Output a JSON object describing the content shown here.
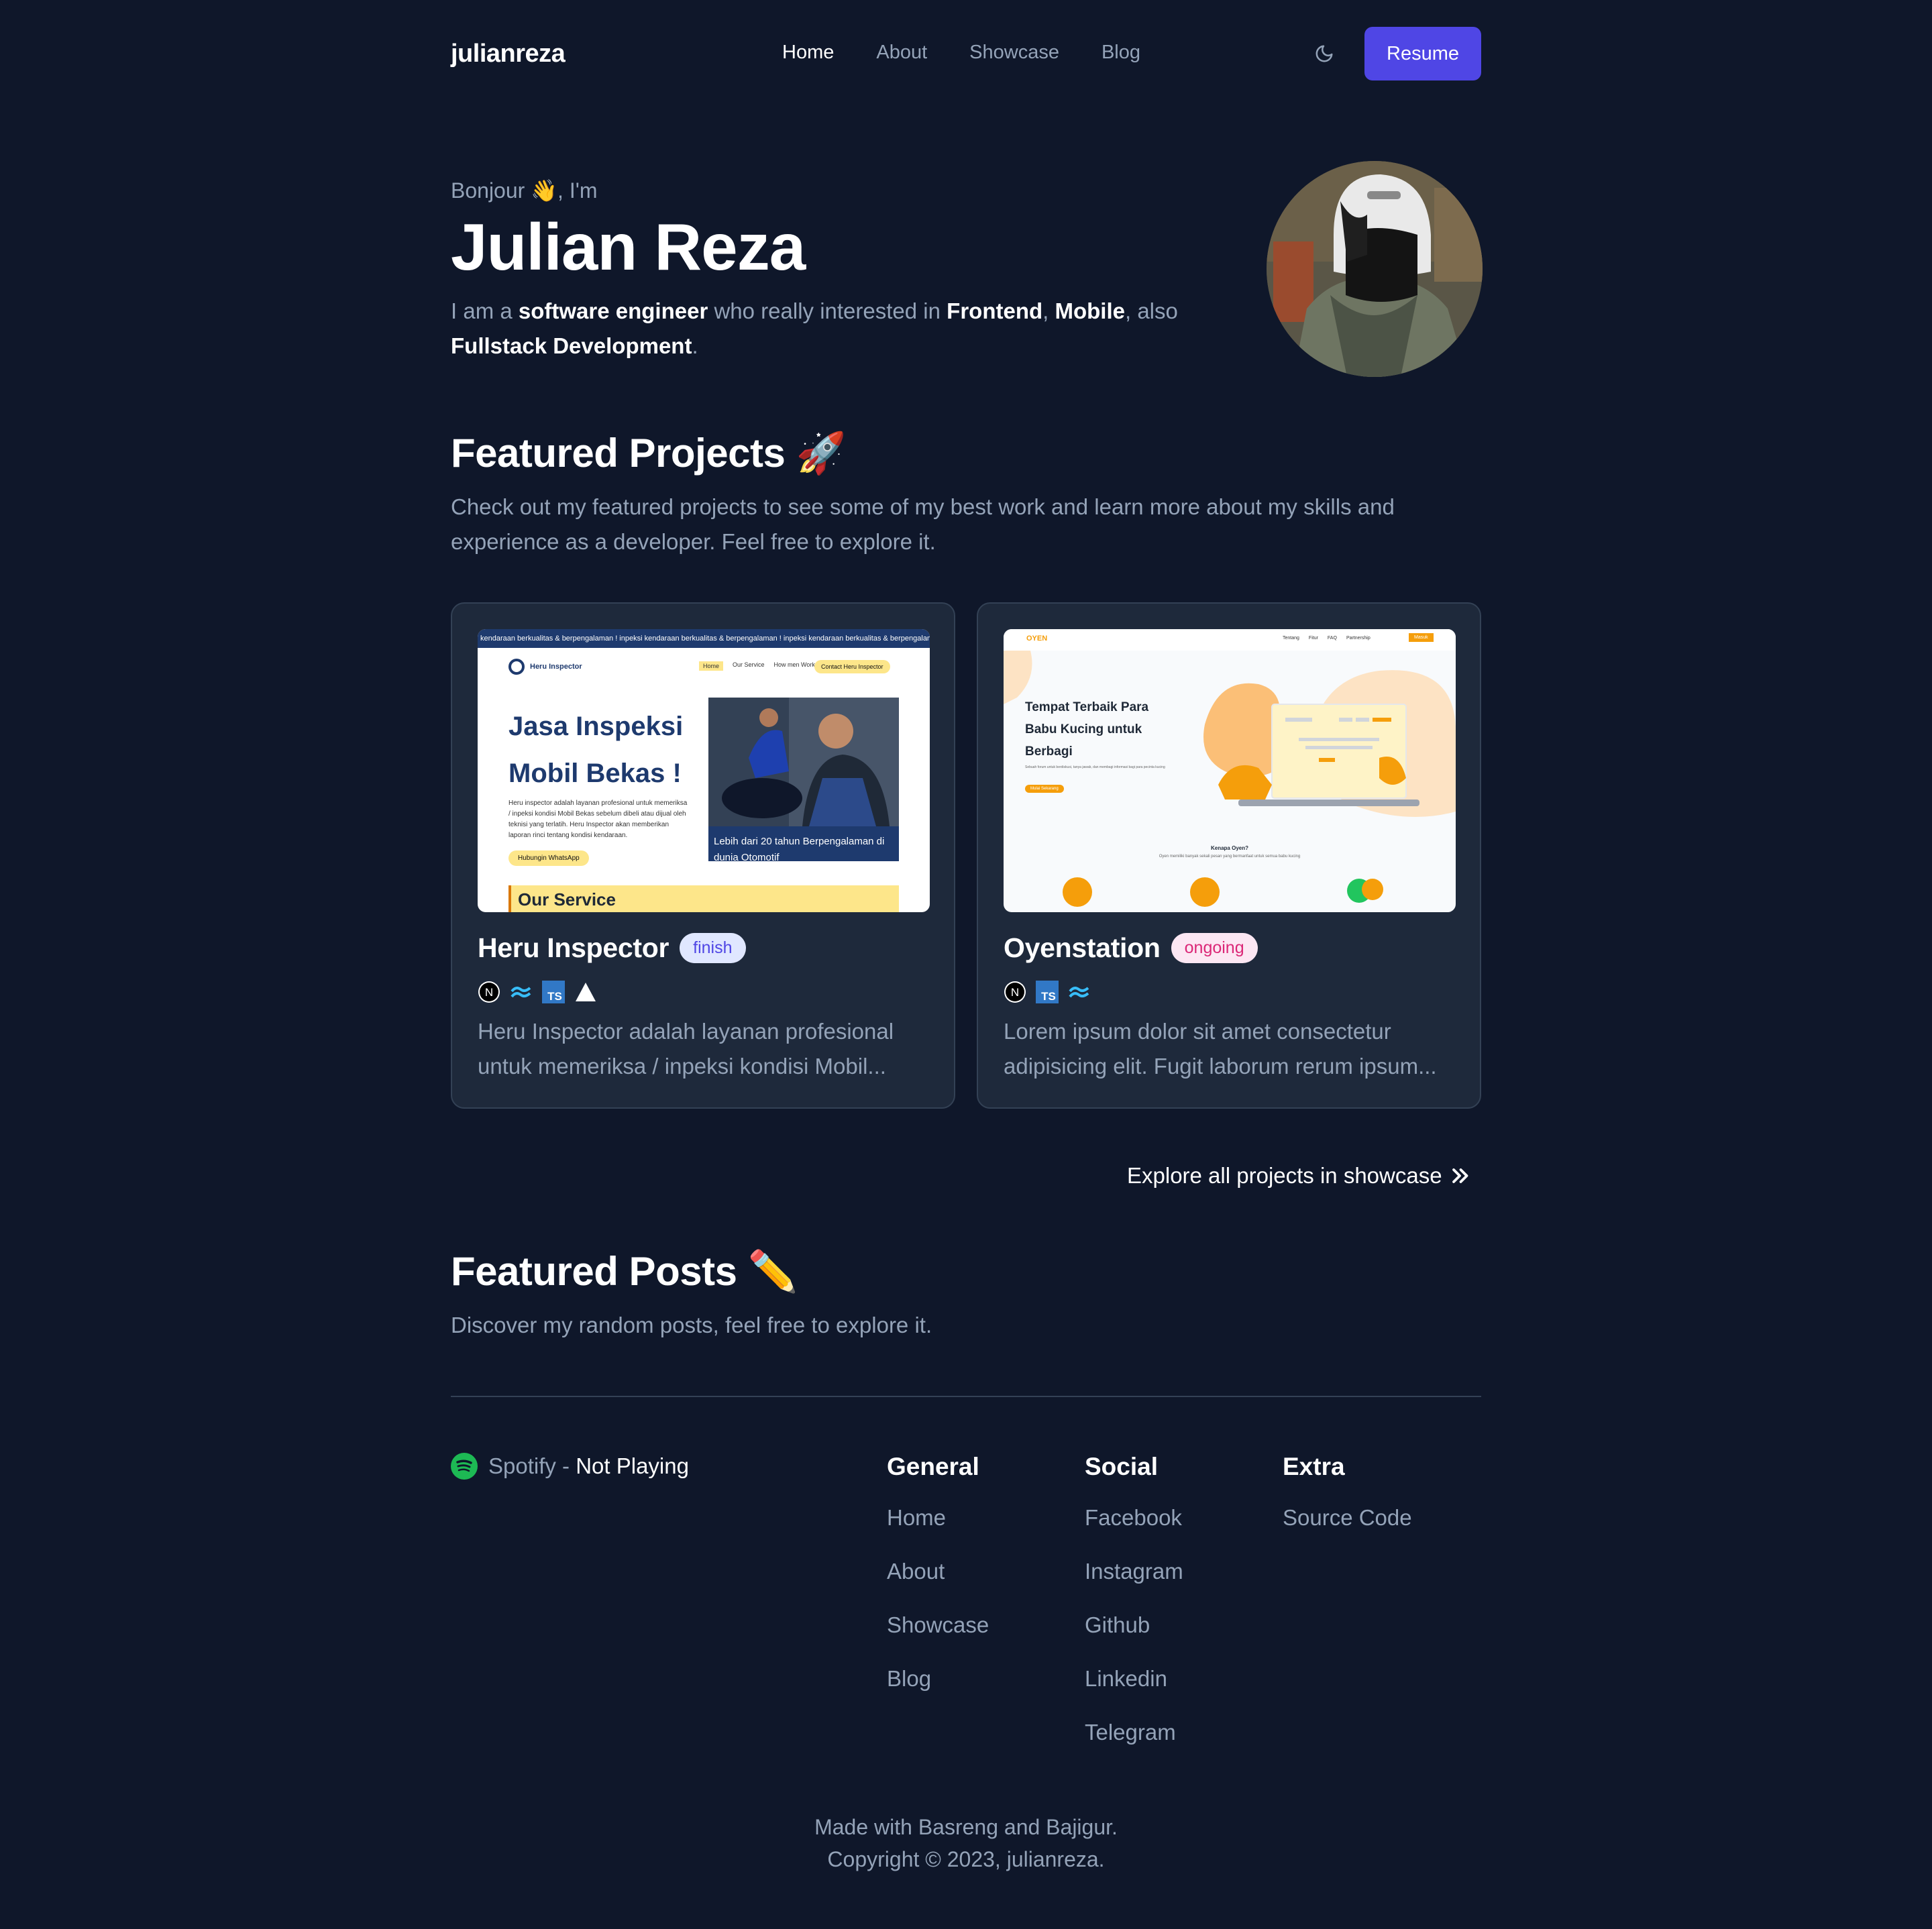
{
  "nav": {
    "logo": "julianreza",
    "links": [
      {
        "label": "Home",
        "active": true
      },
      {
        "label": "About",
        "active": false
      },
      {
        "label": "Showcase",
        "active": false
      },
      {
        "label": "Blog",
        "active": false
      }
    ],
    "theme_icon": "moon-icon",
    "resume_label": "Resume"
  },
  "hero": {
    "greeting_prefix": "Bonjour",
    "greeting_emoji": "👋",
    "greeting_suffix": ", I'm",
    "name": "Julian Reza",
    "desc_1": "I am a ",
    "desc_role": "software engineer",
    "desc_2": " who really interested in ",
    "desc_frontend": "Frontend",
    "desc_comma": ", ",
    "desc_mobile": "Mobile",
    "desc_3": ", also ",
    "desc_fullstack": "Fullstack Development",
    "desc_end": "."
  },
  "projects": {
    "title": "Featured Projects",
    "title_emoji": "🚀",
    "subtitle": "Check out my featured projects to see some of my best work and learn more about my skills and experience as a developer. Feel free to explore it.",
    "items": [
      {
        "name": "Heru Inspector",
        "status": "finish",
        "tech": [
          "nextjs-icon",
          "tailwind-icon",
          "typescript-icon",
          "vercel-icon"
        ],
        "desc": "Heru Inspector adalah layanan profesional untuk memeriksa / inpeksi kondisi Mobil...",
        "thumb": {
          "marquee": "kendaraan berkualitas & berpengalaman ! inpeksi kendaraan berkualitas & berpengalaman ! inpeksi kendaraan berkualitas & berpengalaman !",
          "brand": "Heru Inspector",
          "menu": [
            "Home",
            "Our Service",
            "How men Work"
          ],
          "contact": "Contact Heru Inspector",
          "headline_1": "Jasa Inspeksi",
          "headline_2": "Mobil Bekas !",
          "body": "Heru inspector adalah layanan profesional untuk memeriksa / inpeksi kondisi Mobil Bekas sebelum dibeli atau dijual oleh teknisi yang terlatih. Heru Inspector akan memberikan laporan rinci tentang kondisi kendaraan.",
          "cta": "Hubungin WhatsApp",
          "photo_caption": "Lebih dari 20 tahun Berpengalaman di dunia Otomotif",
          "service": "Our Service"
        }
      },
      {
        "name": "Oyenstation",
        "status": "ongoing",
        "tech": [
          "nextjs-icon",
          "typescript-icon",
          "tailwind-icon"
        ],
        "desc": "Lorem ipsum dolor sit amet consectetur adipisicing elit. Fugit laborum rerum ipsum...",
        "thumb": {
          "brand": "OYEN",
          "menu": [
            "Tentang",
            "Fitur",
            "FAQ",
            "Partnership"
          ],
          "menu_btn": "Masuk",
          "headline": "Tempat Terbaik Para Babu Kucing untuk Berbagi",
          "body": "Sebuah forum untuk berdiskusi, tanya jawab, dan membagi informasi bagi para pecinta kucing",
          "cta": "Mulai Sekarang",
          "section_title": "Kenapa Oyen?",
          "section_body": "Oyen memiliki banyak sekali pesan yang bermanfaat untuk semua babu kucing"
        }
      }
    ],
    "explore_label": "Explore all projects in showcase"
  },
  "posts": {
    "title": "Featured Posts",
    "title_emoji": "✏️",
    "subtitle": "Discover my random posts, feel free to explore it."
  },
  "footer": {
    "spotify_label": "Spotify",
    "spotify_sep": " - ",
    "spotify_status": "Not Playing",
    "columns": [
      {
        "title": "General",
        "links": [
          "Home",
          "About",
          "Showcase",
          "Blog"
        ]
      },
      {
        "title": "Social",
        "links": [
          "Facebook",
          "Instagram",
          "Github",
          "Linkedin",
          "Telegram"
        ]
      },
      {
        "title": "Extra",
        "links": [
          "Source Code"
        ]
      }
    ],
    "made_with": "Made with Basreng and Bajigur.",
    "copyright": "Copyright © 2023, julianreza."
  },
  "colors": {
    "background": "#0f172a",
    "card": "#1e293b",
    "accent": "#4f46e5",
    "spotify": "#1db954"
  }
}
